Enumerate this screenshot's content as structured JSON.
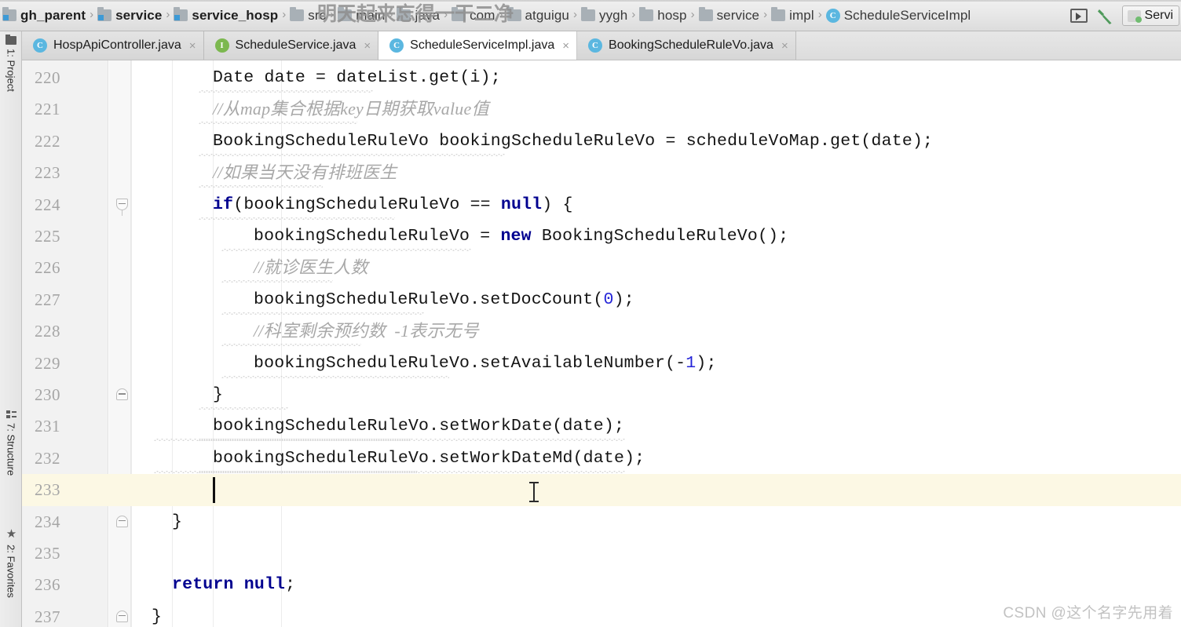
{
  "window": {
    "watermark_top": "明天起来忘得一干二净",
    "watermark_bottom": "CSDN @这个名字先用着"
  },
  "breadcrumb": {
    "items": [
      {
        "label": "gh_parent",
        "icon": "module-folder-icon",
        "bold": true
      },
      {
        "label": "service",
        "icon": "module-folder-icon",
        "bold": true
      },
      {
        "label": "service_hosp",
        "icon": "module-folder-icon",
        "bold": true
      },
      {
        "label": "src",
        "icon": "folder-icon",
        "bold": false
      },
      {
        "label": "main",
        "icon": "folder-icon",
        "bold": false
      },
      {
        "label": "java",
        "icon": "folder-icon",
        "bold": false
      },
      {
        "label": "com",
        "icon": "folder-icon",
        "bold": false
      },
      {
        "label": "atguigu",
        "icon": "folder-icon",
        "bold": false
      },
      {
        "label": "yygh",
        "icon": "folder-icon",
        "bold": false
      },
      {
        "label": "hosp",
        "icon": "folder-icon",
        "bold": false
      },
      {
        "label": "service",
        "icon": "folder-icon",
        "bold": false
      },
      {
        "label": "impl",
        "icon": "folder-icon",
        "bold": false
      },
      {
        "label": "ScheduleServiceImpl",
        "icon": "class-icon",
        "bold": false
      }
    ],
    "separator": "›"
  },
  "toolbar": {
    "run_window_icon": "run-window-icon",
    "build_icon": "hammer-build-icon",
    "run_config_label": "Servi",
    "run_config_icon": "run-configuration-icon"
  },
  "left_tool_window": {
    "tabs": [
      {
        "label": "1: Project",
        "icon": "project-folder-icon"
      },
      {
        "label": "7: Structure",
        "icon": "structure-icon"
      },
      {
        "label": "2: Favorites",
        "icon": "star-icon"
      }
    ]
  },
  "editor_tabs": [
    {
      "label": "HospApiController.java",
      "icon": "class-icon",
      "icon_letter": "C",
      "active": false,
      "close": "×"
    },
    {
      "label": "ScheduleService.java",
      "icon": "interface-icon",
      "icon_letter": "I",
      "active": false,
      "close": "×"
    },
    {
      "label": "ScheduleServiceImpl.java",
      "icon": "class-icon",
      "icon_letter": "C",
      "active": true,
      "close": "×"
    },
    {
      "label": "BookingScheduleRuleVo.java",
      "icon": "class-icon",
      "icon_letter": "C",
      "active": false,
      "close": "×"
    }
  ],
  "editor": {
    "highlighted_line": 233,
    "caret_line": 233,
    "lines": [
      {
        "n": "220",
        "indent": 8,
        "tokens": [
          {
            "t": "Date date = dateList.get(i);",
            "c": "plain"
          }
        ]
      },
      {
        "n": "221",
        "indent": 8,
        "tokens": [
          {
            "t": "//从map集合根据key日期获取value值",
            "c": "cmt"
          }
        ]
      },
      {
        "n": "222",
        "indent": 8,
        "tokens": [
          {
            "t": "BookingScheduleRuleVo bookingScheduleRuleVo = scheduleVoMap.get(date);",
            "c": "plain"
          }
        ]
      },
      {
        "n": "223",
        "indent": 8,
        "tokens": [
          {
            "t": "//如果当天没有排班医生",
            "c": "cmt"
          }
        ]
      },
      {
        "n": "224",
        "indent": 8,
        "fold": "start",
        "tokens": [
          {
            "t": "if",
            "c": "kw"
          },
          {
            "t": "(bookingScheduleRuleVo == ",
            "c": "plain"
          },
          {
            "t": "null",
            "c": "kw"
          },
          {
            "t": ") {",
            "c": "plain"
          }
        ]
      },
      {
        "n": "225",
        "indent": 12,
        "tokens": [
          {
            "t": "bookingScheduleRuleVo = ",
            "c": "plain"
          },
          {
            "t": "new",
            "c": "kw"
          },
          {
            "t": " BookingScheduleRuleVo();",
            "c": "plain"
          }
        ]
      },
      {
        "n": "226",
        "indent": 12,
        "tokens": [
          {
            "t": "//就诊医生人数",
            "c": "cmt"
          }
        ]
      },
      {
        "n": "227",
        "indent": 12,
        "tokens": [
          {
            "t": "bookingScheduleRuleVo.setDocCount(",
            "c": "plain"
          },
          {
            "t": "0",
            "c": "num"
          },
          {
            "t": ");",
            "c": "plain"
          }
        ]
      },
      {
        "n": "228",
        "indent": 12,
        "tokens": [
          {
            "t": "//科室剩余预约数  -1表示无号",
            "c": "cmt"
          }
        ]
      },
      {
        "n": "229",
        "indent": 12,
        "tokens": [
          {
            "t": "bookingScheduleRuleVo.setAvailableNumber(-",
            "c": "plain"
          },
          {
            "t": "1",
            "c": "num"
          },
          {
            "t": ");",
            "c": "plain"
          }
        ]
      },
      {
        "n": "230",
        "indent": 8,
        "fold": "end",
        "tokens": [
          {
            "t": "}",
            "c": "plain"
          }
        ]
      },
      {
        "n": "231",
        "indent": 8,
        "tokens": [
          {
            "t": "bookingScheduleRuleVo.setWorkDate(date);",
            "c": "plain"
          }
        ]
      },
      {
        "n": "232",
        "indent": 8,
        "tokens": [
          {
            "t": "bookingScheduleRuleVo.setWorkDateMd(date);",
            "c": "plain"
          }
        ]
      },
      {
        "n": "233",
        "indent": 8,
        "tokens": []
      },
      {
        "n": "234",
        "indent": 4,
        "fold": "end",
        "tokens": [
          {
            "t": "}",
            "c": "plain"
          }
        ]
      },
      {
        "n": "235",
        "indent": 4,
        "tokens": []
      },
      {
        "n": "236",
        "indent": 4,
        "tokens": [
          {
            "t": "return",
            "c": "kw"
          },
          {
            "t": " ",
            "c": "plain"
          },
          {
            "t": "null",
            "c": "kw"
          },
          {
            "t": ";",
            "c": "plain"
          }
        ]
      },
      {
        "n": "237",
        "indent": 2,
        "fold": "end",
        "tokens": [
          {
            "t": "}",
            "c": "plain"
          }
        ]
      }
    ]
  }
}
